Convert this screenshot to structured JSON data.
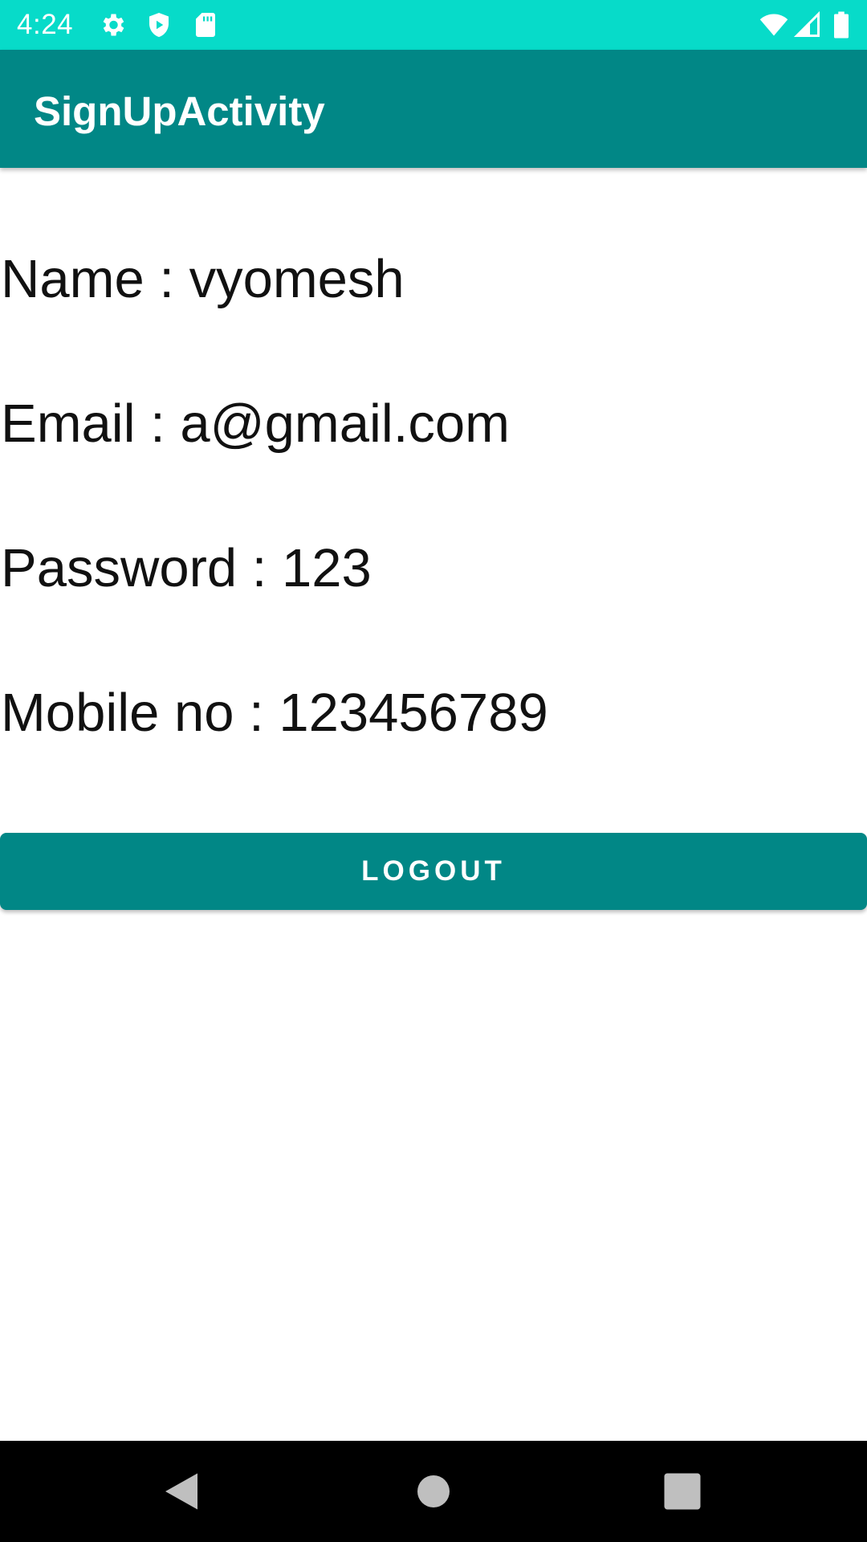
{
  "status_bar": {
    "time": "4:24",
    "left_icons": [
      "gear-icon",
      "shield-icon",
      "sd-card-icon"
    ],
    "right_icons": [
      "wifi-icon",
      "cell-signal-icon",
      "battery-icon"
    ],
    "background_color": "#07DBC9"
  },
  "app_bar": {
    "title": "SignUpActivity",
    "background_color": "#018786"
  },
  "profile": {
    "name_line": "Name : vyomesh",
    "email_line": "Email : a@gmail.com",
    "password_line": "Password : 123",
    "mobile_line": "Mobile no : 123456789"
  },
  "logout_button": {
    "label": "LOGOUT",
    "background_color": "#018786"
  },
  "nav_bar": {
    "buttons": [
      "back-icon",
      "home-icon",
      "recents-icon"
    ],
    "background_color": "#000000"
  }
}
